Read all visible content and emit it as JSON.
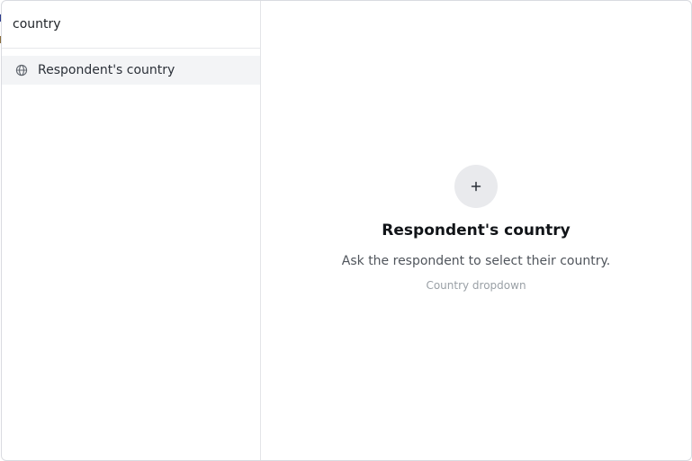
{
  "search": {
    "value": "country",
    "placeholder": ""
  },
  "results": [
    {
      "label": "Respondent's country",
      "icon": "globe-icon"
    }
  ],
  "preview": {
    "add_icon": "plus-icon",
    "title": "Respondent's country",
    "description": "Ask the respondent to select their country.",
    "type_label": "Country dropdown"
  },
  "colors": {
    "border": "#d9dbe0",
    "selected_bg": "#f3f4f6",
    "add_circle_bg": "#e9eaed",
    "muted_text": "#9aa0a6"
  }
}
